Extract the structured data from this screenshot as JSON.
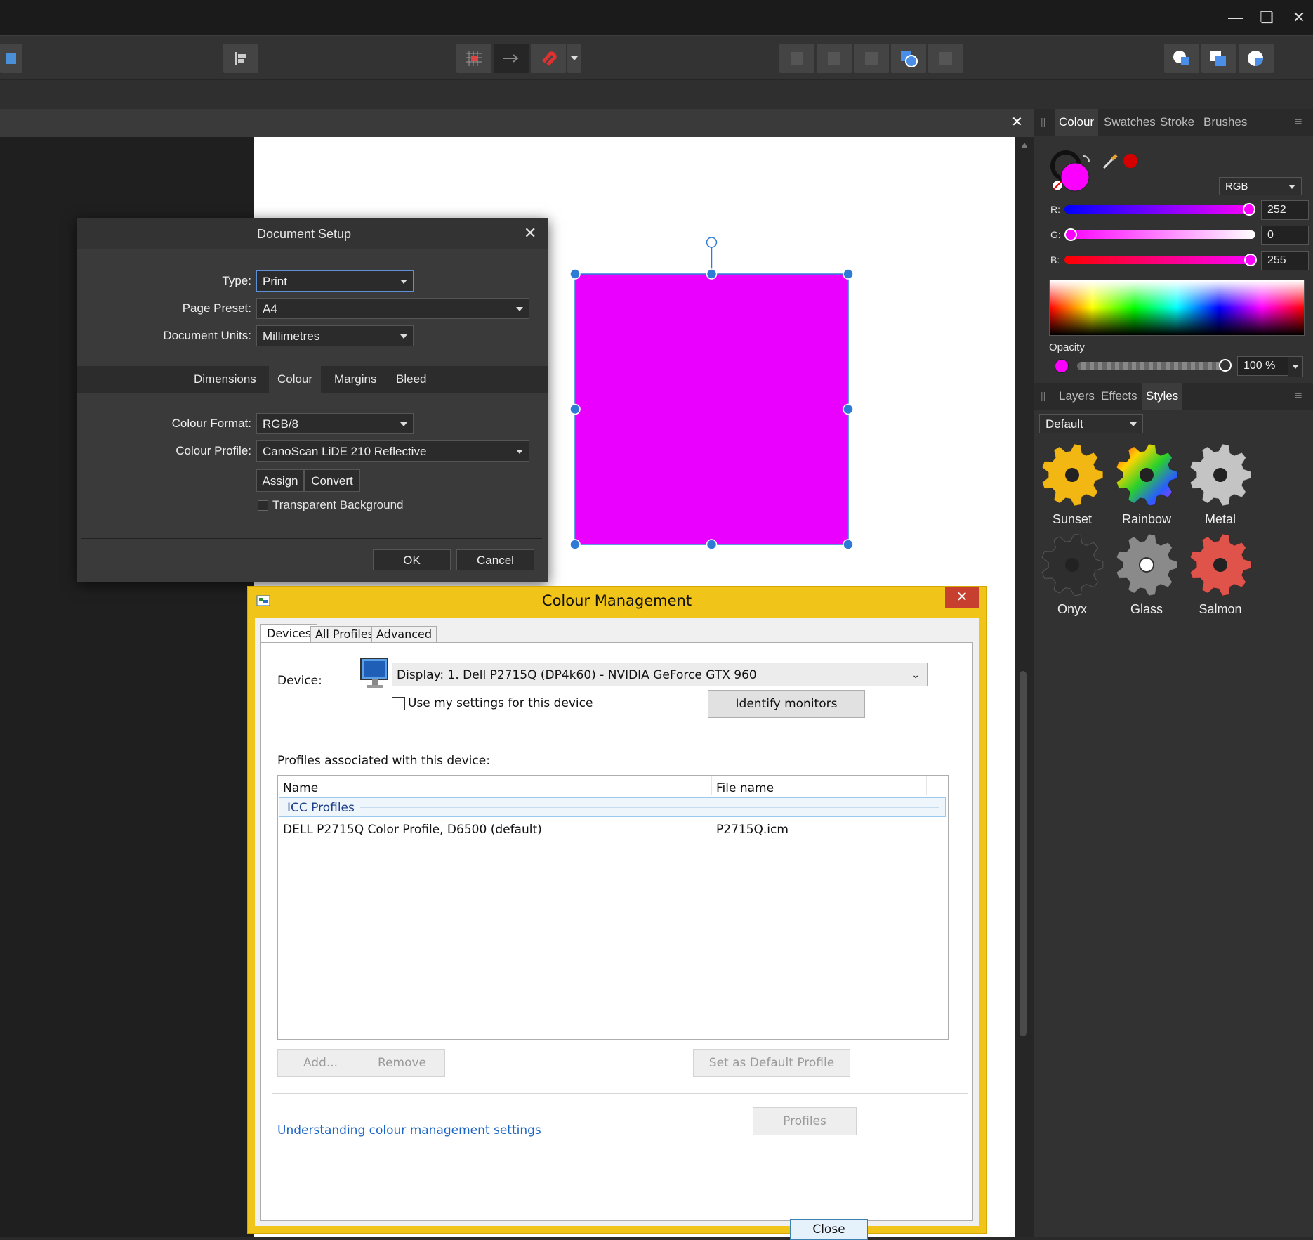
{
  "window": {
    "minimize_icon": "minimize-icon",
    "restore_icon": "restore-icon"
  },
  "colour_panel": {
    "tabs": [
      "Colour",
      "Swatches",
      "Stroke",
      "Brushes"
    ],
    "active_tab": "Colour",
    "mode": "RGB",
    "r_label": "R:",
    "g_label": "G:",
    "b_label": "B:",
    "r": "252",
    "g": "0",
    "b": "255",
    "opacity_label": "Opacity",
    "opacity": "100 %",
    "fill_color": "#fc00ff",
    "picker_color": "#d40000"
  },
  "styles_panel": {
    "tabs": [
      "Layers",
      "Effects",
      "Styles"
    ],
    "active_tab": "Styles",
    "category": "Default",
    "styles": [
      "Sunset",
      "Rainbow",
      "Metal",
      "Onyx",
      "Glass",
      "Salmon"
    ]
  },
  "canvas": {
    "shape_color": "#ea00ff",
    "selection_color": "#2e7bd6"
  },
  "document_setup": {
    "title": "Document Setup",
    "type_label": "Type:",
    "type_value": "Print",
    "preset_label": "Page Preset:",
    "preset_value": "A4",
    "units_label": "Document Units:",
    "units_value": "Millimetres",
    "tabs": [
      "Dimensions",
      "Colour",
      "Margins",
      "Bleed"
    ],
    "active_tab": "Colour",
    "format_label": "Colour Format:",
    "format_value": "RGB/8",
    "profile_label": "Colour Profile:",
    "profile_value": "CanoScan LiDE 210 Reflective",
    "assign_label": "Assign",
    "convert_label": "Convert",
    "transparent_label": "Transparent Background",
    "ok_label": "OK",
    "cancel_label": "Cancel"
  },
  "colour_management": {
    "title": "Colour Management",
    "tabs": [
      "Devices",
      "All Profiles",
      "Advanced"
    ],
    "active_tab": "Devices",
    "device_label": "Device:",
    "device_value": "Display: 1. Dell P2715Q (DP4k60) - NVIDIA GeForce GTX 960",
    "use_settings_label": "Use my settings for this device",
    "identify_label": "Identify monitors",
    "profiles_heading": "Profiles associated with this device:",
    "col_name": "Name",
    "col_file": "File name",
    "group_label": "ICC Profiles",
    "rows": [
      {
        "name": "DELL P2715Q Color Profile, D6500 (default)",
        "file": "P2715Q.icm"
      }
    ],
    "add_label": "Add...",
    "remove_label": "Remove",
    "set_default_label": "Set as Default Profile",
    "link_label": "Understanding colour management settings",
    "profiles_label": "Profiles",
    "close_label": "Close"
  }
}
